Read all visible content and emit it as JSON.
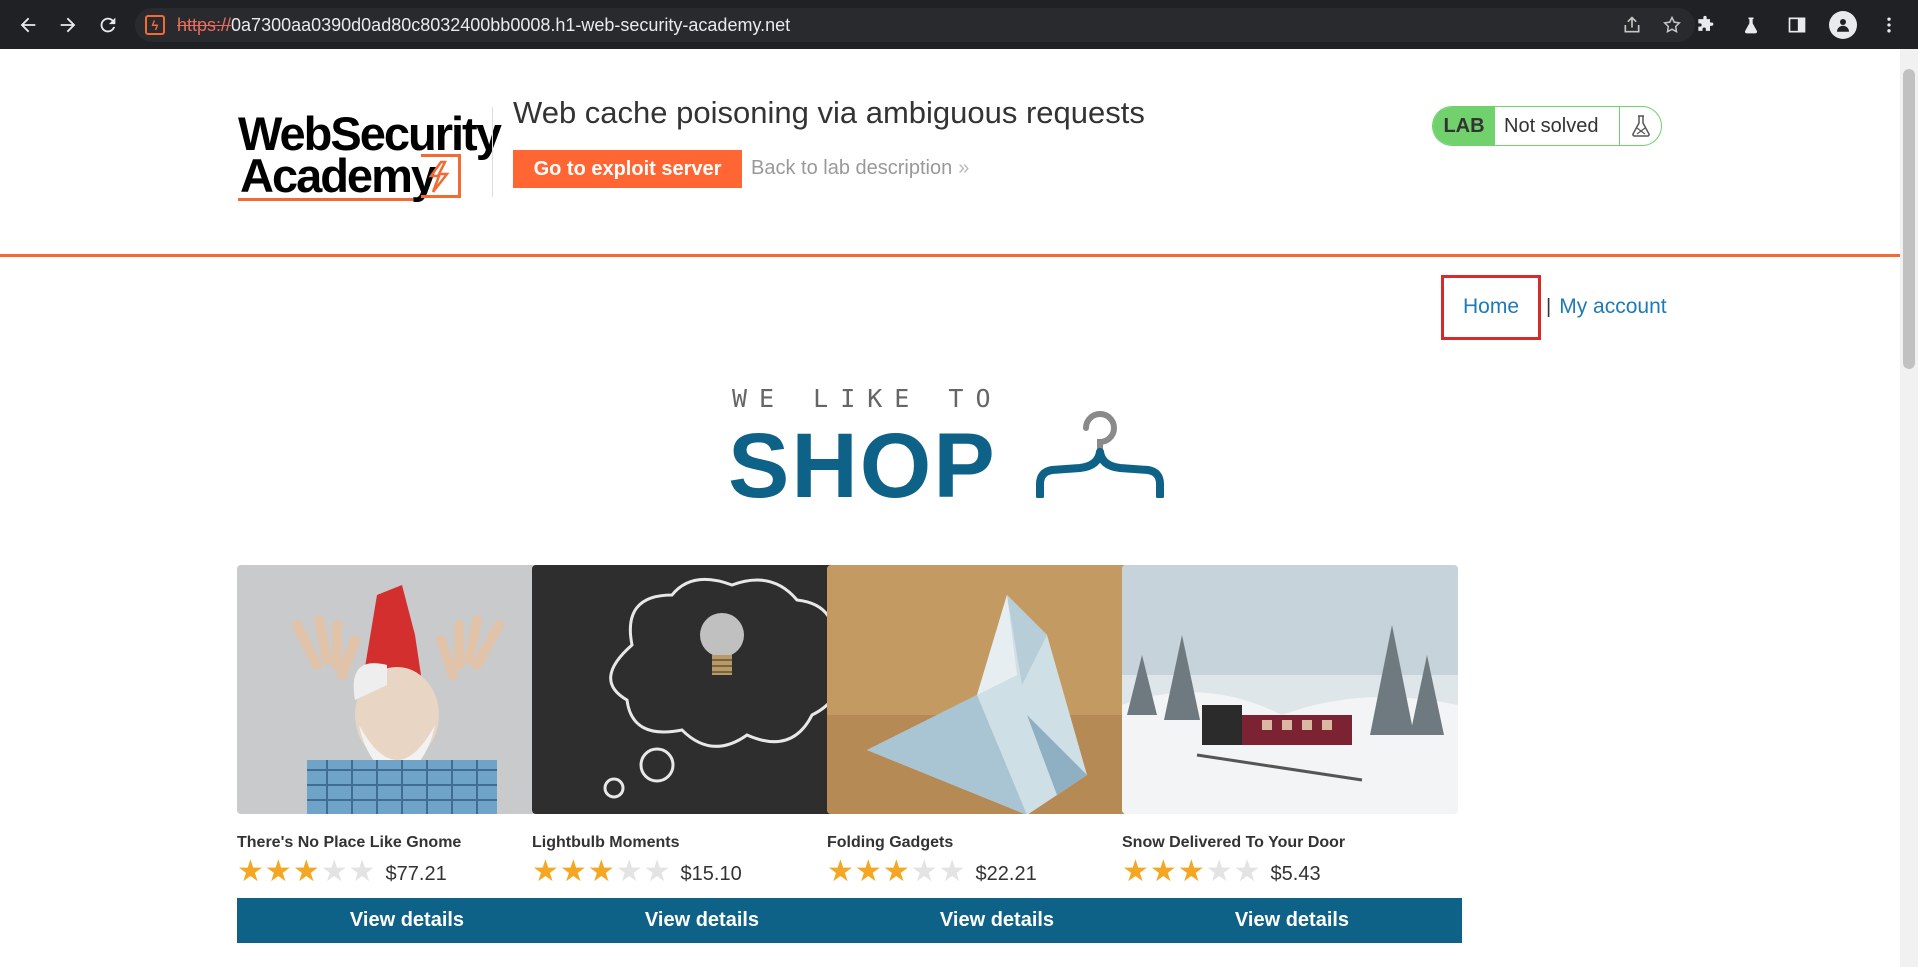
{
  "browser": {
    "url_scheme": "https://",
    "url_rest": "0a7300aa0390d0ad80c8032400bb0008.h1-web-security-academy.net"
  },
  "lab": {
    "logo_line1": "WebSecurity",
    "logo_line2": "Academy",
    "title": "Web cache poisoning via ambiguous requests",
    "exploit_button": "Go to exploit server",
    "back_link": "Back to lab description",
    "back_chevrons": "»",
    "badge": "LAB",
    "status": "Not solved"
  },
  "nav": {
    "home": "Home",
    "separator": "|",
    "account": "My account"
  },
  "shop": {
    "tagline": "WE LIKE TO",
    "word": "SHOP"
  },
  "products": [
    {
      "name": "There's No Place Like Gnome",
      "rating": 3,
      "price": "$77.21",
      "button": "View details"
    },
    {
      "name": "Lightbulb Moments",
      "rating": 3,
      "price": "$15.10",
      "button": "View details"
    },
    {
      "name": "Folding Gadgets",
      "rating": 3,
      "price": "$22.21",
      "button": "View details"
    },
    {
      "name": "Snow Delivered To Your Door",
      "rating": 3,
      "price": "$5.43",
      "button": "View details"
    }
  ],
  "colors": {
    "accent": "#ff6633",
    "primary": "#0f6287",
    "link": "#1d7ab8",
    "lab_green": "#70d16d",
    "star": "#f5a623",
    "highlight": "#d72b2b"
  }
}
